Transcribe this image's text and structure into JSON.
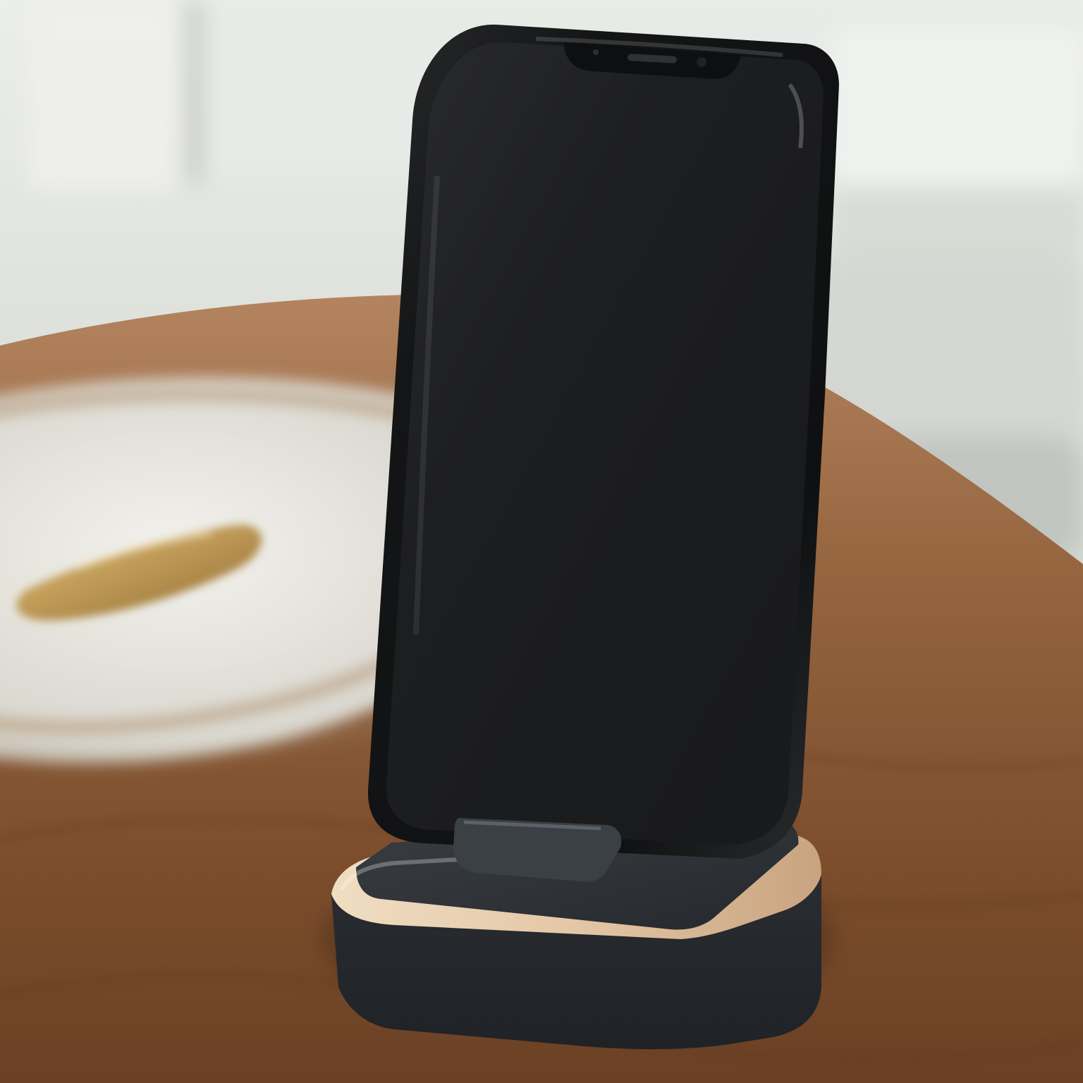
{
  "scene": {
    "subject": "",
    "colors": {
      "wall": "#dfe2de",
      "window_frame": "#aeb2ad",
      "table_wood": "#8a5d38",
      "plate": "#e8e7e1",
      "plate_rim": "#b18d62",
      "spoon": "#c8a35e",
      "phone": "#141516",
      "phone_screen": "#1c1d1f",
      "stand_black": "#2c2f33",
      "stand_wood": "#e6cdb0"
    }
  }
}
